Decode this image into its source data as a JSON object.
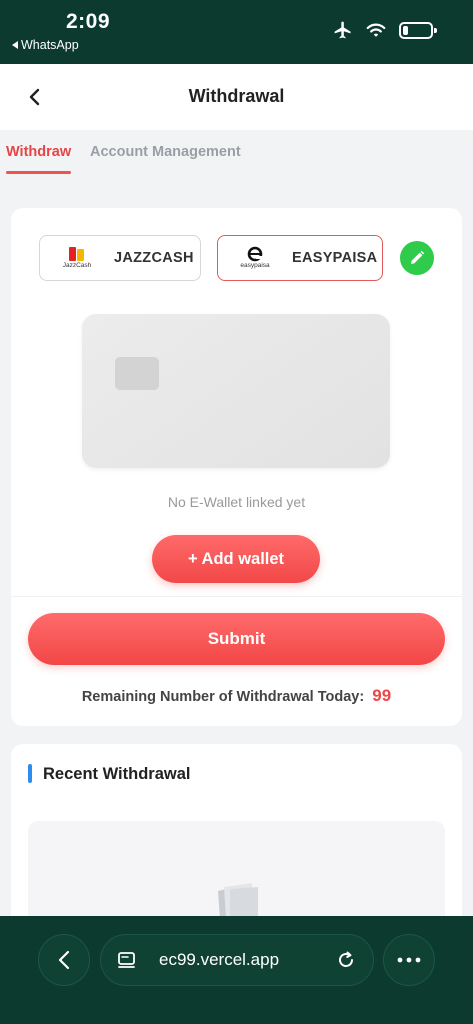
{
  "status_bar": {
    "time": "2:09",
    "back_app": "WhatsApp",
    "icons": [
      "airplane-icon",
      "wifi-icon",
      "battery-icon"
    ]
  },
  "header": {
    "title": "Withdrawal",
    "back_icon": "chevron-left-icon"
  },
  "tabs": [
    {
      "label": "Withdraw",
      "active": true
    },
    {
      "label": "Account Management",
      "active": false
    }
  ],
  "wallet_options": [
    {
      "label": "JAZZCASH",
      "logo_text": "JazzCash",
      "selected": false
    },
    {
      "label": "EASYPAISA",
      "logo_text": "easypaisa",
      "selected": true
    }
  ],
  "edit_icon": "pencil-icon",
  "empty_message": "No E-Wallet linked yet",
  "add_wallet_label": "+ Add wallet",
  "submit_label": "Submit",
  "remaining": {
    "label": "Remaining Number of Withdrawal Today:",
    "count": "99"
  },
  "recent": {
    "title": "Recent Withdrawal",
    "empty_icon": "empty-folder-icon"
  },
  "browser": {
    "url": "ec99.vercel.app",
    "icons": [
      "back-icon",
      "tab-icon",
      "reload-icon",
      "more-icon"
    ]
  },
  "colors": {
    "accent_red": "#ef4747",
    "edit_green": "#2ecc4a",
    "status_bg": "#0c3a2e",
    "section_bar_blue": "#2d8cf0"
  }
}
